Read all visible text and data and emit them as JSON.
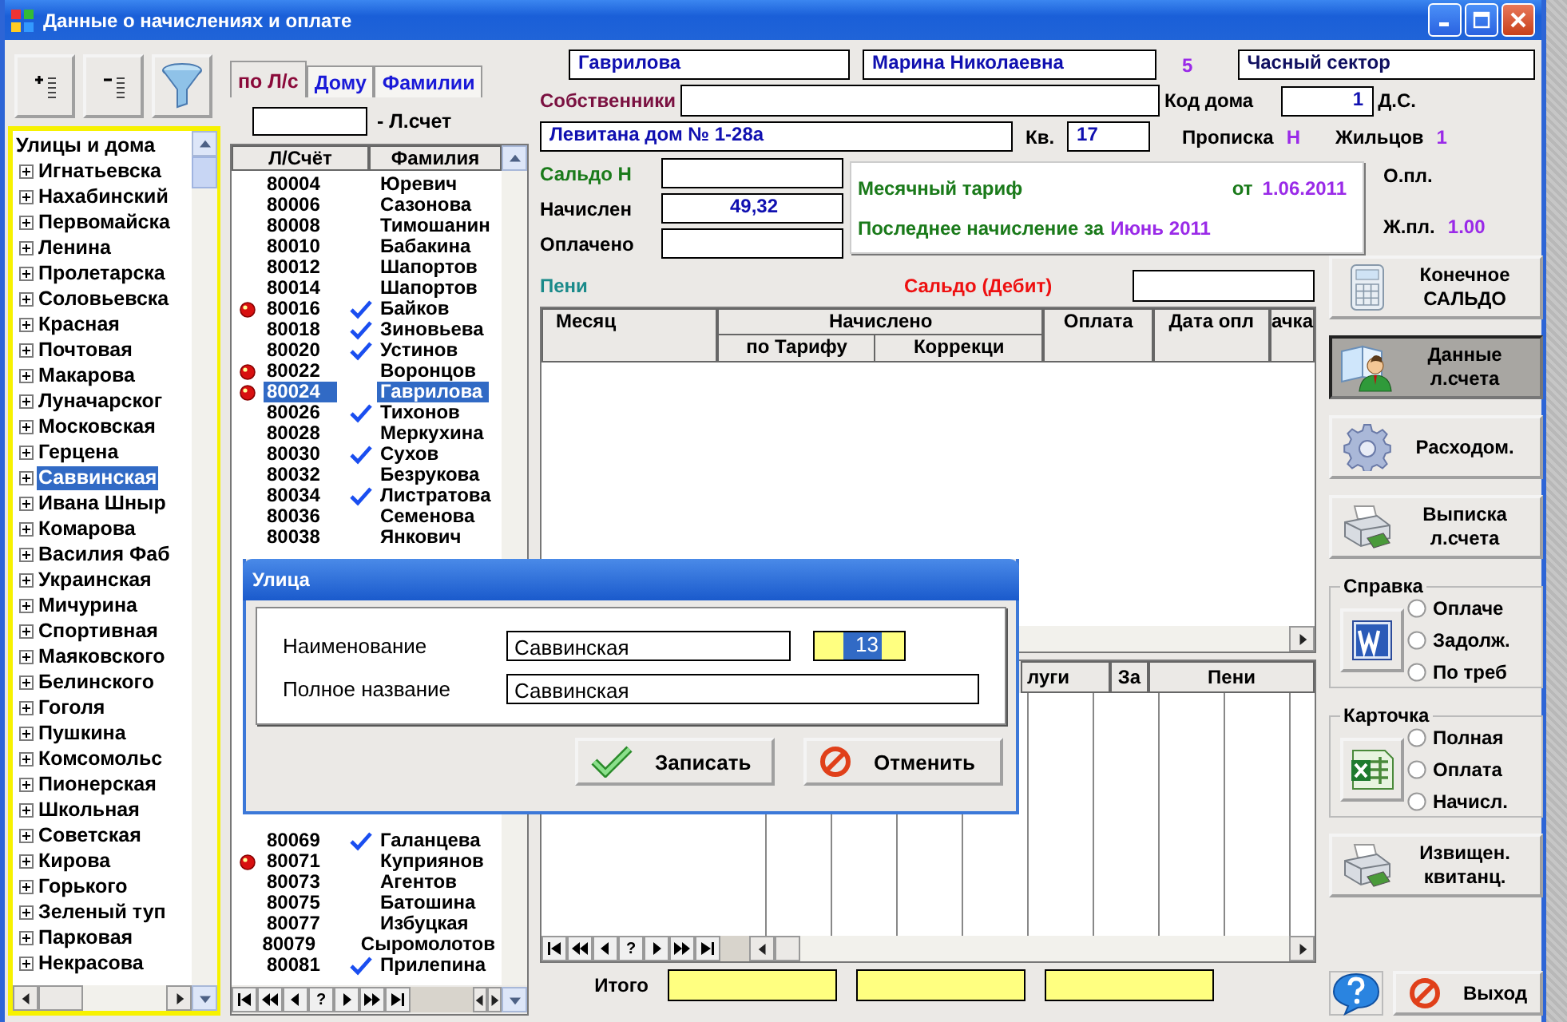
{
  "window": {
    "title": "Данные о начислениях и оплате"
  },
  "tree": {
    "label": "Улицы и дома",
    "children": [
      {
        "label": "Игнатьевска",
        "expanded": false,
        "selected": false
      },
      {
        "label": "Нахабинский",
        "expanded": false,
        "selected": false
      },
      {
        "label": "Первомайска",
        "expanded": false,
        "selected": false
      },
      {
        "label": "Ленина",
        "expanded": false,
        "selected": false
      },
      {
        "label": "Пролетарска",
        "expanded": false,
        "selected": false
      },
      {
        "label": "Соловьевска",
        "expanded": false,
        "selected": false
      },
      {
        "label": "Красная",
        "expanded": false,
        "selected": false
      },
      {
        "label": "Почтовая",
        "expanded": false,
        "selected": false
      },
      {
        "label": "Макарова",
        "expanded": false,
        "selected": false
      },
      {
        "label": "Луначарског",
        "expanded": false,
        "selected": false
      },
      {
        "label": "Московская",
        "expanded": false,
        "selected": false
      },
      {
        "label": "Герцена",
        "expanded": false,
        "selected": false
      },
      {
        "label": "Саввинская",
        "expanded": false,
        "selected": true
      },
      {
        "label": "Ивана Шныр",
        "expanded": false,
        "selected": false
      },
      {
        "label": "Комарова",
        "expanded": false,
        "selected": false
      },
      {
        "label": "Василия Фаб",
        "expanded": false,
        "selected": false
      },
      {
        "label": "Украинская",
        "expanded": false,
        "selected": false
      },
      {
        "label": "Мичурина",
        "expanded": false,
        "selected": false
      },
      {
        "label": "Спортивная",
        "expanded": false,
        "selected": false
      },
      {
        "label": "Маяковского",
        "expanded": false,
        "selected": false
      },
      {
        "label": "Белинского",
        "expanded": false,
        "selected": false
      },
      {
        "label": "Гоголя",
        "expanded": false,
        "selected": false
      },
      {
        "label": "Пушкина",
        "expanded": false,
        "selected": false
      },
      {
        "label": "Комсомольс",
        "expanded": false,
        "selected": false
      },
      {
        "label": "Пионерская",
        "expanded": false,
        "selected": false
      },
      {
        "label": "Школьная",
        "expanded": false,
        "selected": false
      },
      {
        "label": "Советская",
        "expanded": false,
        "selected": false
      },
      {
        "label": "Кирова",
        "expanded": false,
        "selected": false
      },
      {
        "label": "Горького",
        "expanded": false,
        "selected": false
      },
      {
        "label": "Зеленый туп",
        "expanded": false,
        "selected": false
      },
      {
        "label": "Парковая",
        "expanded": false,
        "selected": false
      },
      {
        "label": "Некрасова",
        "expanded": false,
        "selected": false
      }
    ]
  },
  "tabs": [
    {
      "label": "по Л/с",
      "selected": true
    },
    {
      "label": "Дому",
      "selected": false
    },
    {
      "label": "Фамилии",
      "selected": false
    }
  ],
  "account_search": {
    "label": "- Л.счет"
  },
  "accounts": {
    "columns": [
      "Л/Счёт",
      "Фамилия"
    ],
    "rows": [
      {
        "account": "80004",
        "name": "Юревич",
        "marker": false,
        "checked": false,
        "selected": false
      },
      {
        "account": "80006",
        "name": "Сазонова",
        "marker": false,
        "checked": false,
        "selected": false
      },
      {
        "account": "80008",
        "name": "Тимошанин",
        "marker": false,
        "checked": false,
        "selected": false
      },
      {
        "account": "80010",
        "name": "Бабакина",
        "marker": false,
        "checked": false,
        "selected": false
      },
      {
        "account": "80012",
        "name": "Шапортов",
        "marker": false,
        "checked": false,
        "selected": false
      },
      {
        "account": "80014",
        "name": "Шапортов",
        "marker": false,
        "checked": false,
        "selected": false
      },
      {
        "account": "80016",
        "name": "Байков",
        "marker": true,
        "checked": true,
        "selected": false
      },
      {
        "account": "80018",
        "name": "Зиновьева",
        "marker": false,
        "checked": true,
        "selected": false
      },
      {
        "account": "80020",
        "name": "Устинов",
        "marker": false,
        "checked": true,
        "selected": false
      },
      {
        "account": "80022",
        "name": "Воронцов",
        "marker": true,
        "checked": false,
        "selected": false
      },
      {
        "account": "80024",
        "name": "Гаврилова",
        "marker": true,
        "checked": false,
        "selected": true
      },
      {
        "account": "80026",
        "name": "Тихонов",
        "marker": false,
        "checked": true,
        "selected": false
      },
      {
        "account": "80028",
        "name": "Меркухина",
        "marker": false,
        "checked": false,
        "selected": false
      },
      {
        "account": "80030",
        "name": "Сухов",
        "marker": false,
        "checked": true,
        "selected": false
      },
      {
        "account": "80032",
        "name": "Безрукова",
        "marker": false,
        "checked": false,
        "selected": false
      },
      {
        "account": "80034",
        "name": "Листратова",
        "marker": false,
        "checked": true,
        "selected": false
      },
      {
        "account": "80036",
        "name": "Семенова",
        "marker": false,
        "checked": false,
        "selected": false
      },
      {
        "account": "80038",
        "name": "Янкович",
        "marker": false,
        "checked": false,
        "selected": false
      }
    ],
    "rows_lower": [
      {
        "account": "80069",
        "name": "Галанцева",
        "marker": false,
        "checked": true,
        "selected": false
      },
      {
        "account": "80071",
        "name": "Куприянов",
        "marker": true,
        "checked": false,
        "selected": false
      },
      {
        "account": "80073",
        "name": "Агентов",
        "marker": false,
        "checked": false,
        "selected": false
      },
      {
        "account": "80075",
        "name": "Батошина",
        "marker": false,
        "checked": false,
        "selected": false
      },
      {
        "account": "80077",
        "name": "Избуцкая",
        "marker": false,
        "checked": false,
        "selected": false
      },
      {
        "account": "80079",
        "name": "Сыромолотов",
        "marker": false,
        "checked": false,
        "selected": false
      },
      {
        "account": "80081",
        "name": "Прилепина",
        "marker": false,
        "checked": true,
        "selected": false
      }
    ],
    "nav": [
      {
        "kind": "first"
      },
      {
        "kind": "prev-page"
      },
      {
        "kind": "prev"
      },
      {
        "kind": "find",
        "label": "?"
      },
      {
        "kind": "next"
      },
      {
        "kind": "next-page"
      },
      {
        "kind": "last"
      }
    ]
  },
  "person": {
    "surname": "Гаврилова",
    "name": "Марина Николаевна",
    "number": "5",
    "sector": "Часный сектор",
    "owners_label": "Собственники",
    "house_code_label": "Код дома",
    "house_code": "1",
    "ds_label": "Д.С.",
    "address": "Левитана дом № 1-28а",
    "apt_label": "Кв.",
    "apt": "17",
    "registration_label": "Прописка",
    "registration": "Н",
    "residents_label": "Жильцов",
    "residents": "1"
  },
  "balance": [
    {
      "label": "Сальдо Н",
      "kind": "opening"
    },
    {
      "label": "Начислен",
      "kind": "plain",
      "value": "49,32"
    },
    {
      "label": "Оплачено",
      "kind": "plain"
    }
  ],
  "tariff": {
    "label": "Месячный тариф",
    "from_label": "от",
    "from": "1.06.2011",
    "last_label": "Последнее начисление за",
    "last": "Июнь 2011"
  },
  "area": {
    "total_label": "О.пл.",
    "living_label": "Ж.пл.",
    "living": "1.00"
  },
  "penalty_label": "Пени",
  "debit_label": "Сальдо (Дебит)",
  "charges_grid": {
    "columns": [
      {
        "label": "Месяц"
      },
      {
        "label": "Начислено",
        "children": [
          {
            "label": "по Тарифу"
          },
          {
            "label": "Коррекци"
          }
        ]
      },
      {
        "label": "Оплата"
      },
      {
        "label": "Дата опл"
      },
      {
        "label": "ачка"
      }
    ]
  },
  "services_grid": {
    "columns": [
      "луги",
      "За",
      "Пени"
    ],
    "nav": [
      {
        "kind": "first"
      },
      {
        "kind": "prev-page"
      },
      {
        "kind": "prev"
      },
      {
        "kind": "find",
        "label": "?"
      },
      {
        "kind": "next"
      },
      {
        "kind": "next-page"
      },
      {
        "kind": "last"
      }
    ]
  },
  "totals": {
    "label": "Итого"
  },
  "actions": [
    {
      "kind": "balance",
      "label": "Конечное\nСАЛЬДО",
      "pressed": false
    },
    {
      "kind": "account",
      "label": "Данные\nл.счета",
      "pressed": true
    },
    {
      "kind": "expense",
      "label": "Расходом.",
      "pressed": false
    },
    {
      "kind": "statement",
      "label": "Выписка\nл.счета",
      "pressed": false
    },
    {
      "kind": "report-group",
      "title": "Справка",
      "options": [
        {
          "label": "Оплаче",
          "selected": false
        },
        {
          "label": "Задолж.",
          "selected": false
        },
        {
          "label": "По треб",
          "selected": false
        }
      ]
    },
    {
      "kind": "card-group",
      "title": "Карточка",
      "options": [
        {
          "label": "Полная",
          "selected": false
        },
        {
          "label": "Оплата",
          "selected": false
        },
        {
          "label": "Начисл.",
          "selected": false
        }
      ]
    },
    {
      "kind": "notice",
      "label": "Извищен.\nквитанц.",
      "pressed": false
    }
  ],
  "exit": {
    "label": "Выход"
  },
  "dialog": {
    "title": "Улица",
    "fields": [
      {
        "label": "Наименование",
        "value": "Саввинская",
        "code": "13",
        "code_selected": true
      },
      {
        "label": "Полное название",
        "value": "Саввинская"
      }
    ],
    "buttons": [
      {
        "kind": "save",
        "label": "Записать"
      },
      {
        "kind": "cancel",
        "label": "Отменить"
      }
    ]
  }
}
